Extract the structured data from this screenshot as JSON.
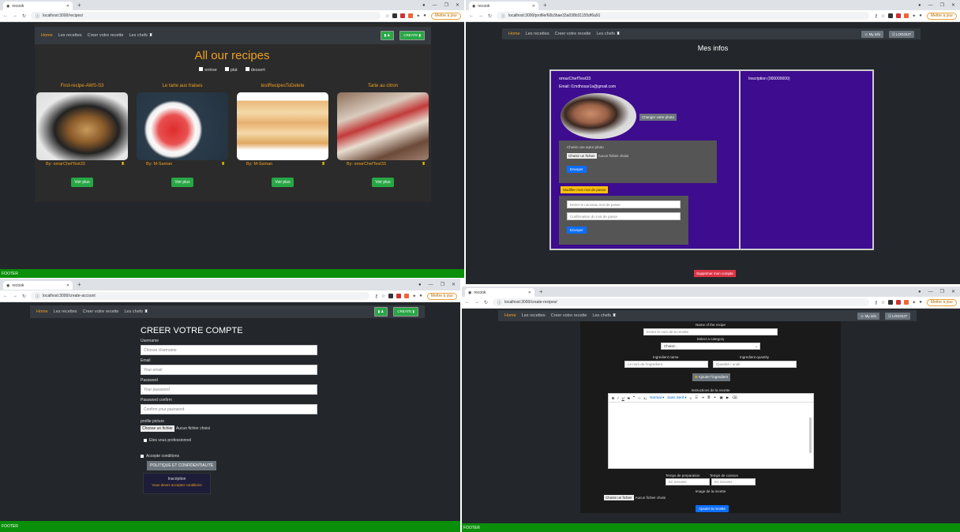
{
  "browser": {
    "tab_title": "recook",
    "maj_label": "Mettre à jour",
    "urls": {
      "q1": "localhost:3000/recipes/",
      "q2": "localhost:3000/profile/60b3bae33a038b31155df6a91",
      "q3": "localhost:3000/create-account",
      "q4": "localhost:3000/create-recipes/"
    }
  },
  "nav": {
    "home": "Home",
    "recettes": "Les recettes",
    "creer": "Creer votre recette",
    "chefs": "Les chefs",
    "create_btn": "CREATE",
    "my_info": "My info",
    "logout": "LOGOUT"
  },
  "footer_label": "FOOTER",
  "recipes_page": {
    "title": "All our recipes",
    "filters": [
      "entree",
      "plat",
      "dessert"
    ],
    "cards": [
      {
        "title": "First-recipe-AWS-S3",
        "author": "By: omarChefTest33",
        "button": "Voir plus"
      },
      {
        "title": "Le tarte aux fraises",
        "author": "By: M-Saman",
        "button": "Voir plus"
      },
      {
        "title": "testRecipesToDelete",
        "author": "By: M-Saman",
        "button": "Voir plus"
      },
      {
        "title": "Tarte au citron",
        "author": "By: omarChefTest33",
        "button": "Voir plus"
      }
    ]
  },
  "profile_page": {
    "title": "Mes infos",
    "username": "omarChefTest33",
    "email": "Email: l1mdhosar1a@gmail.com",
    "change_photo": "Changer votre photo",
    "choose_photo": "Choisir une autre photo",
    "file_btn": "Choisir un fichier",
    "file_none": "Aucun fichier choisi",
    "send": "Envoyer",
    "modify_pw": "Modifier mon mot de passe",
    "new_pw_placeholder": "Entrer le nouveau mot de passe",
    "confirm_pw_placeholder": "Confirmation du mot de passe",
    "right_text": "Inscription (000000000)",
    "delete_account": "Supprimer mon compte"
  },
  "signup_page": {
    "title": "CREER VOTRE COMPTE",
    "username_label": "Username",
    "username_ph": "Choose Username",
    "email_label": "Email",
    "email_ph": "Your email",
    "password_label": "Password",
    "password_ph": "Your password",
    "confirm_label": "Password confirm",
    "confirm_ph": "Confirm your password",
    "picture_label": "profile picture",
    "file_btn": "Choose un fichier",
    "file_none": "Aucun fichier choisi",
    "pro_label": "Etes vous professionnel",
    "accept_label": "Accepte conditions",
    "policy_btn": "POLITIQUE ET CONFIDENTIALITE",
    "inscription": "Inscription",
    "must_accept": "Vous devez accepter conditions"
  },
  "create_page": {
    "name_label": "Name of the recipe",
    "name_ph": "Entrer le nom de la recette",
    "cat_label": "Select a category",
    "cat_value": "Choisir...",
    "ing_name_label": "Ingredient name",
    "ing_name_ph": "Le nom de l'ingredient",
    "ing_qty_label": "Ingredient quantity",
    "ing_qty_ph": "Quantité / unité",
    "add_ing": "Ajouter l'ingredient",
    "instr_label": "Instructions de la recette",
    "format_label": "Normal",
    "font_label": "Sans Serif",
    "prep_label": "Temps de preparation",
    "cook_label": "Temps de cuisson",
    "time_ph": "En minutes",
    "image_label": "Image de la recette",
    "file_btn": "Choisir un fichier",
    "file_none": "Aucun fichier choisi",
    "submit": "Ajouter la recette"
  },
  "colors": {
    "accent": "#f0a020",
    "profile_bg": "#3d0c8f",
    "footer": "#0a8f0a",
    "success": "#28a745"
  }
}
